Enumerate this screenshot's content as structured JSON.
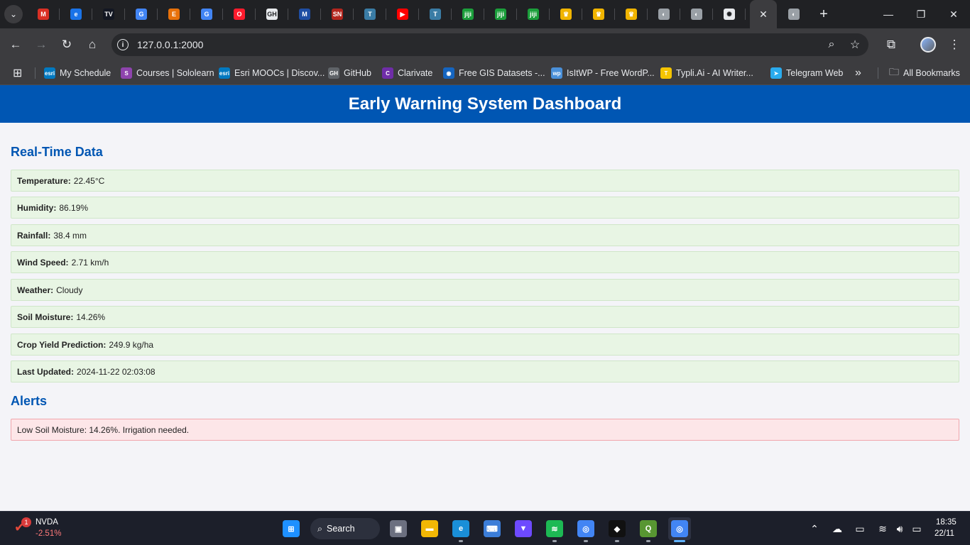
{
  "browser": {
    "tabs": [
      {
        "icon": "gmail-icon",
        "color": "#d93025",
        "glyph": "M"
      },
      {
        "icon": "edge-icon",
        "color": "#1a73e8",
        "glyph": "e"
      },
      {
        "icon": "tradingview-icon",
        "color": "#131722",
        "glyph": "TV"
      },
      {
        "icon": "google-icon",
        "color": "#4285f4",
        "glyph": "G"
      },
      {
        "icon": "e-icon",
        "color": "#e8710a",
        "glyph": "E"
      },
      {
        "icon": "google-icon",
        "color": "#4285f4",
        "glyph": "G"
      },
      {
        "icon": "opera-icon",
        "color": "#ff1b2d",
        "glyph": "O"
      },
      {
        "icon": "github-icon",
        "color": "#e8eaed",
        "glyph": "GH"
      },
      {
        "icon": "mendeley-icon",
        "color": "#1f4ea3",
        "glyph": "M"
      },
      {
        "icon": "sn-icon",
        "color": "#b3261e",
        "glyph": "SN"
      },
      {
        "icon": "typeface-icon",
        "color": "#3a7ca5",
        "glyph": "T"
      },
      {
        "icon": "youtube-icon",
        "color": "#ff0000",
        "glyph": "▶"
      },
      {
        "icon": "typeface-icon",
        "color": "#3a7ca5",
        "glyph": "T"
      },
      {
        "icon": "jiji-icon",
        "color": "#1b9e3b",
        "glyph": "jiji"
      },
      {
        "icon": "jiji-icon",
        "color": "#1b9e3b",
        "glyph": "jiji"
      },
      {
        "icon": "jiji-icon",
        "color": "#1b9e3b",
        "glyph": "jiji"
      },
      {
        "icon": "crest-icon",
        "color": "#f0b400",
        "glyph": "♛"
      },
      {
        "icon": "crest-icon",
        "color": "#f0b400",
        "glyph": "♛"
      },
      {
        "icon": "crest-icon",
        "color": "#f0b400",
        "glyph": "♛"
      },
      {
        "icon": "globe-icon",
        "color": "#9aa0a6",
        "glyph": "◐"
      },
      {
        "icon": "globe-icon",
        "color": "#9aa0a6",
        "glyph": "◐"
      },
      {
        "icon": "chatgpt-icon",
        "color": "#e8eaed",
        "glyph": "✺"
      }
    ],
    "active_tab_close": "✕",
    "after_active": {
      "icon": "globe-icon",
      "color": "#9aa0a6",
      "glyph": "◐"
    },
    "new_tab": "+",
    "url": "127.0.0.1:2000",
    "bookmarks": [
      {
        "label": "My Schedule",
        "icon": "esri-icon",
        "color": "#0079c1",
        "glyph": "esri"
      },
      {
        "label": "Courses | Sololearn",
        "icon": "sololearn-icon",
        "color": "#8e44ad",
        "glyph": "S"
      },
      {
        "label": "Esri MOOCs | Discov...",
        "icon": "esri-icon",
        "color": "#0079c1",
        "glyph": "esri"
      },
      {
        "label": "GitHub",
        "icon": "github-icon",
        "color": "#5f6368",
        "glyph": "GH"
      },
      {
        "label": "Clarivate",
        "icon": "clarivate-icon",
        "color": "#6f2da8",
        "glyph": "C"
      },
      {
        "label": "Free GIS Datasets -...",
        "icon": "globe-icon",
        "color": "#1565c0",
        "glyph": "◉"
      },
      {
        "label": "IsItWP - Free WordP...",
        "icon": "wp-icon",
        "color": "#4a90d9",
        "glyph": "wp"
      },
      {
        "label": "Typli.Ai - AI Writer...",
        "icon": "typli-icon",
        "color": "#f5c400",
        "glyph": "T"
      },
      {
        "label": "Telegram Web",
        "icon": "telegram-icon",
        "color": "#2aabee",
        "glyph": "➤"
      }
    ],
    "more_bookmarks": "»",
    "all_bookmarks": "All Bookmarks"
  },
  "page": {
    "title": "Early Warning System Dashboard",
    "realtime_heading": "Real-Time Data",
    "rows": [
      {
        "label": "Temperature:",
        "value": "22.45°C"
      },
      {
        "label": "Humidity:",
        "value": "86.19%"
      },
      {
        "label": "Rainfall:",
        "value": "38.4 mm"
      },
      {
        "label": "Wind Speed:",
        "value": "2.71 km/h"
      },
      {
        "label": "Weather:",
        "value": "Cloudy"
      },
      {
        "label": "Soil Moisture:",
        "value": "14.26%"
      },
      {
        "label": "Crop Yield Prediction:",
        "value": "249.9 kg/ha"
      },
      {
        "label": "Last Updated:",
        "value": "2024-11-22 02:03:08"
      }
    ],
    "alerts_heading": "Alerts",
    "alerts": [
      "Low Soil Moisture: 14.26%. Irrigation needed."
    ]
  },
  "taskbar": {
    "stock_badge": "1",
    "stock_name": "NVDA",
    "stock_change": "-2.51%",
    "search_label": "Search",
    "apps": [
      {
        "name": "windows-start-icon",
        "color": "#1e90ff",
        "glyph": "⊞"
      },
      {
        "name": "task-view-icon",
        "color": "#6c7080",
        "glyph": "▣"
      },
      {
        "name": "file-explorer-icon",
        "color": "#f2b705",
        "glyph": "▬"
      },
      {
        "name": "edge-icon",
        "color": "#1a8fd8",
        "glyph": "e"
      },
      {
        "name": "keyboard-app-icon",
        "color": "#3b7dd8",
        "glyph": "⌨"
      },
      {
        "name": "proton-vpn-icon",
        "color": "#6d4aff",
        "glyph": "▼"
      },
      {
        "name": "spotify-icon",
        "color": "#1db954",
        "glyph": "≋"
      },
      {
        "name": "chrome-profile-icon",
        "color": "#4285f4",
        "glyph": "◎"
      },
      {
        "name": "capcut-icon",
        "color": "#111111",
        "glyph": "◆"
      },
      {
        "name": "qgis-icon",
        "color": "#589632",
        "glyph": "Q"
      },
      {
        "name": "chrome-icon",
        "color": "#4285f4",
        "glyph": "◎"
      }
    ],
    "time": "18:35",
    "date": "22/11"
  }
}
